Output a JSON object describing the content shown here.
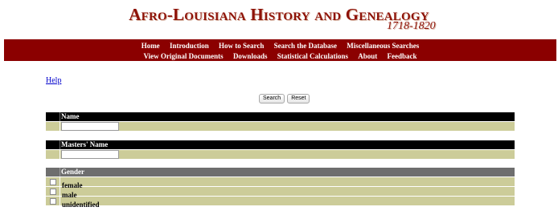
{
  "header": {
    "title": "Afro-Louisiana History and Genealogy",
    "years": "1718-1820"
  },
  "nav": {
    "row1": [
      "Home",
      "Introduction",
      "How to Search",
      "Search the Database",
      "Miscellaneous Searches"
    ],
    "row2": [
      "View Original Documents",
      "Downloads",
      "Statistical Calculations",
      "About",
      "Feedback"
    ]
  },
  "help": {
    "label": "Help"
  },
  "buttons": {
    "search": "Search",
    "reset": "Reset"
  },
  "sections": {
    "name": {
      "label": "Name",
      "value": ""
    },
    "masters_name": {
      "label": "Masters' Name",
      "value": ""
    },
    "gender": {
      "label": "Gender",
      "options": [
        "female",
        "male",
        "unidentified"
      ]
    }
  },
  "colors": {
    "brand": "#8b0000",
    "row_fill": "#cccc99",
    "header_black": "#000000",
    "header_grey": "#6e6e6e"
  }
}
